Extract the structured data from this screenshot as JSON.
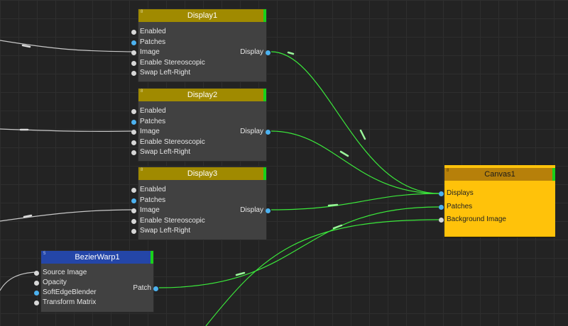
{
  "nodes": {
    "display1": {
      "title": "Display1",
      "index": "8",
      "inputs": [
        "Enabled",
        "Patches",
        "Image",
        "Enable Stereoscopic",
        "Swap Left-Right"
      ],
      "output": "Display"
    },
    "display2": {
      "title": "Display2",
      "index": "8",
      "inputs": [
        "Enabled",
        "Patches",
        "Image",
        "Enable Stereoscopic",
        "Swap Left-Right"
      ],
      "output": "Display"
    },
    "display3": {
      "title": "Display3",
      "index": "8",
      "inputs": [
        "Enabled",
        "Patches",
        "Image",
        "Enable Stereoscopic",
        "Swap Left-Right"
      ],
      "output": "Display"
    },
    "bezierwarp": {
      "title": "BezierWarp1",
      "index": "5",
      "inputs": [
        "Source Image",
        "Opacity",
        "SoftEdgeBlender",
        "Transform Matrix"
      ],
      "output": "Patch"
    },
    "canvas": {
      "title": "Canvas1",
      "index": "8",
      "inputs": [
        "Displays",
        "Patches",
        "Background Image"
      ]
    }
  },
  "colors": {
    "background": "#232323",
    "node_body": "#414141",
    "display_header": "#a08a00",
    "warp_header": "#2446a8",
    "canvas_body": "#ffc20a",
    "canvas_header": "#b7800a",
    "wire_active": "#3be83b",
    "wire_idle": "#c8c8c8",
    "port_blue": "#4cb2f0",
    "port_white": "#d7d7d7"
  }
}
